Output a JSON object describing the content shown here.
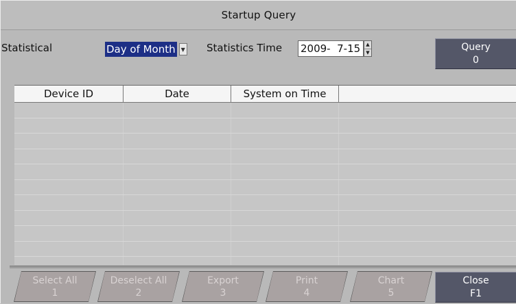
{
  "window": {
    "title": "Startup Query"
  },
  "filters": {
    "statistical_label": "Statistical",
    "statistical_value": "Day of Month",
    "statistics_time_label": "Statistics Time",
    "statistics_time_value": "2009-  7-15"
  },
  "query_button": {
    "label": "Query",
    "shortcut": "0"
  },
  "table": {
    "columns": [
      "Device ID",
      "Date",
      "System on Time",
      ""
    ],
    "rows": []
  },
  "actions": [
    {
      "label": "Select All",
      "shortcut": "1",
      "enabled": false
    },
    {
      "label": "Deselect All",
      "shortcut": "2",
      "enabled": false
    },
    {
      "label": "Export",
      "shortcut": "3",
      "enabled": false
    },
    {
      "label": "Print",
      "shortcut": "4",
      "enabled": false
    },
    {
      "label": "Chart",
      "shortcut": "5",
      "enabled": false
    },
    {
      "label": "Close",
      "shortcut": "F1",
      "enabled": true
    }
  ],
  "colors": {
    "selection": "#1d2f86",
    "button_dark": "#545768",
    "button_disabled": "#a9a2a2"
  }
}
